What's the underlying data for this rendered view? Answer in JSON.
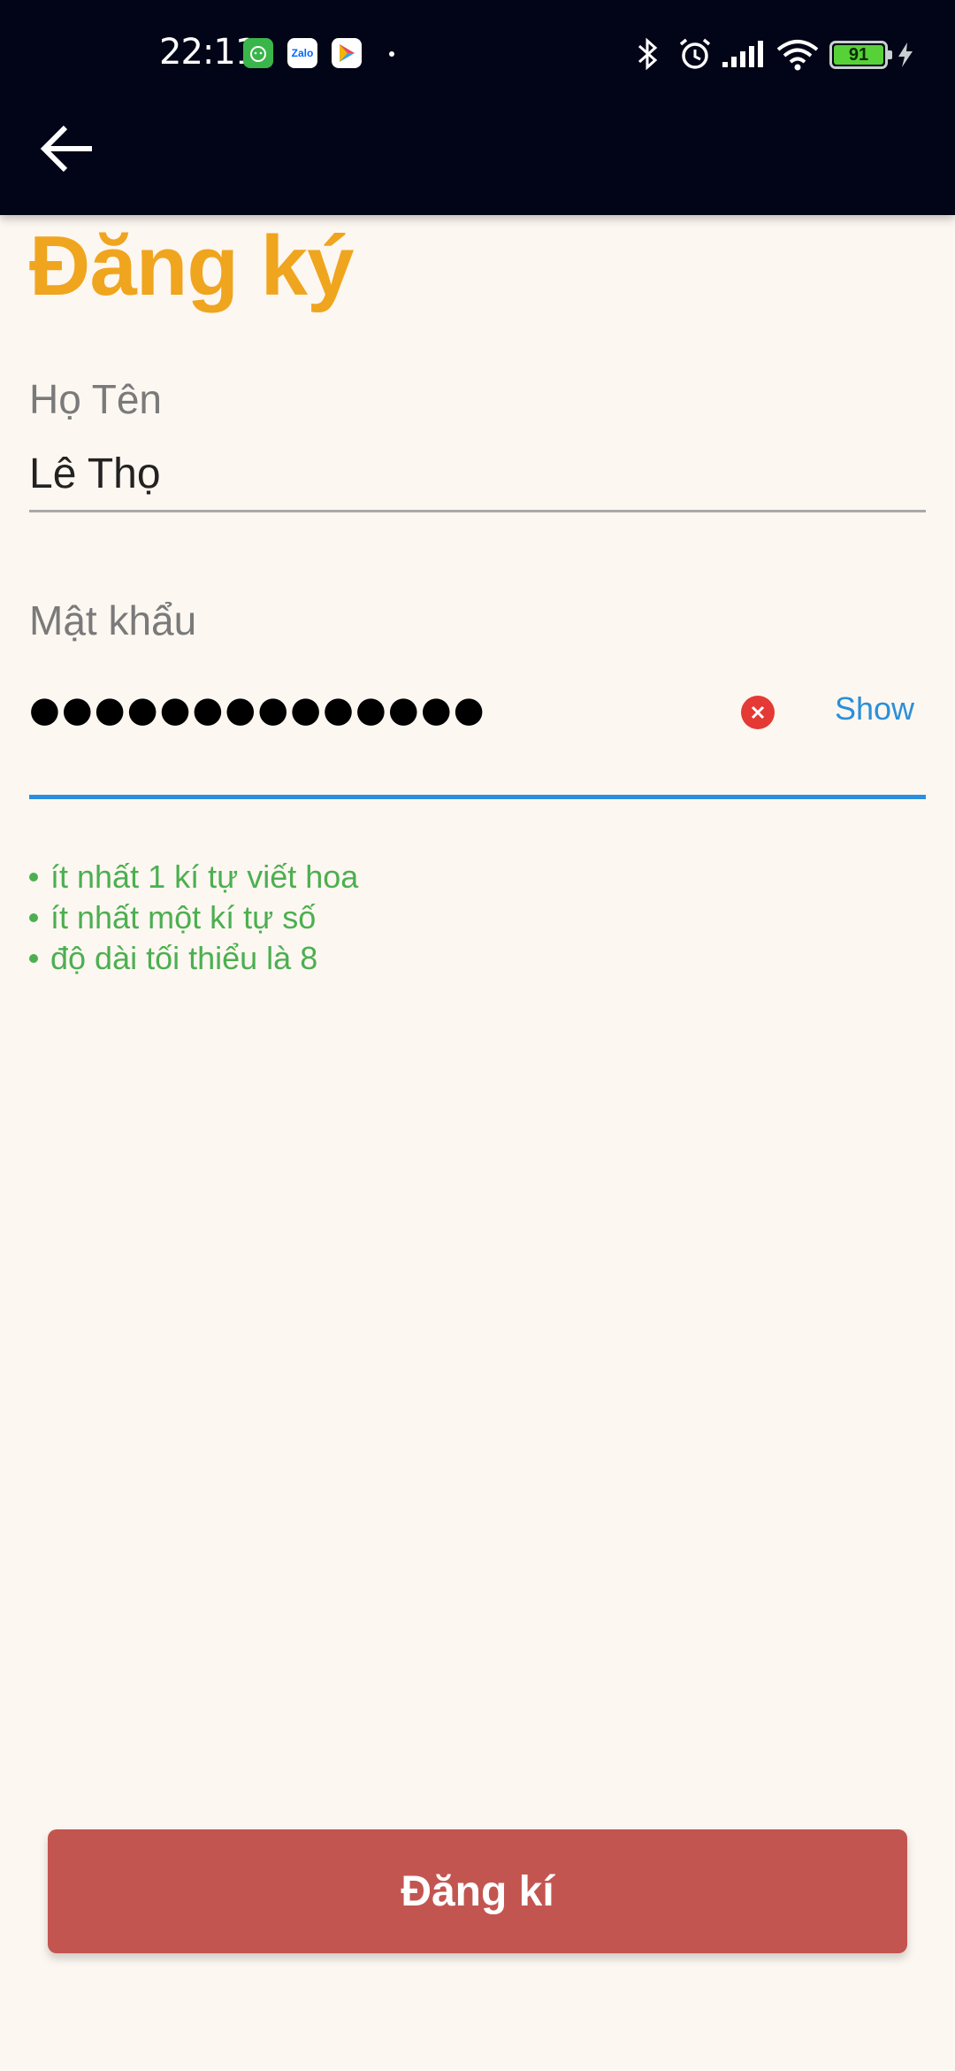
{
  "status_bar": {
    "time": "22:11",
    "notification_icons": [
      "cat-app-icon",
      "zalo-icon",
      "play-store-icon"
    ],
    "zalo_text": "Zalo",
    "battery_level": "91",
    "system_icons": [
      "bluetooth-icon",
      "alarm-icon",
      "signal-icon",
      "wifi-icon",
      "battery-icon",
      "charging-icon"
    ]
  },
  "app_bar": {
    "back_icon": "arrow-left-icon"
  },
  "page": {
    "title": "Đăng ký"
  },
  "form": {
    "name_label": "Họ Tên",
    "name_value": "Lê Thọ",
    "password_label": "Mật khẩu",
    "password_mask": "●●●●●●●●●●●●●●",
    "show_label": "Show",
    "rules": [
      "ít nhất 1 kí tự viết hoa",
      "ít nhất một kí tự số",
      "độ dài tối thiểu là 8"
    ]
  },
  "submit": {
    "label": "Đăng kí"
  },
  "colors": {
    "title": "#f0a51e",
    "rule_text": "#4caf50",
    "submit_bg": "#c35550",
    "focus_line": "#2b8fdf",
    "background": "#fdf7f1",
    "app_bar": "#020417"
  }
}
